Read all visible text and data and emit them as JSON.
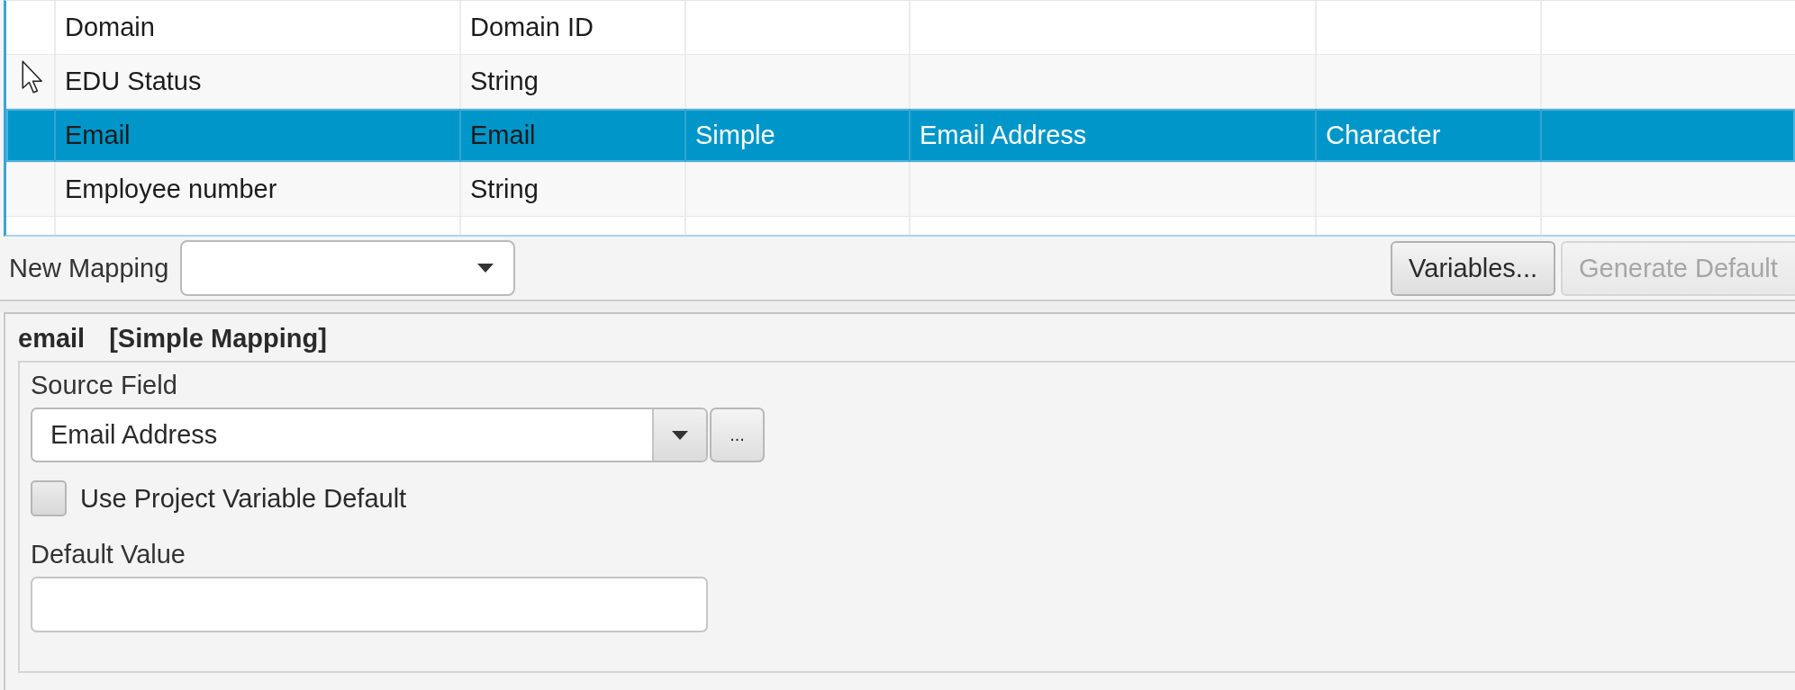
{
  "table": {
    "rows": [
      {
        "selected": false,
        "column_1": "Domain",
        "column_2": "Domain ID"
      },
      {
        "selected": false,
        "column_1": "EDU Status",
        "column_2": "String"
      },
      {
        "selected": true,
        "column_1": "Email",
        "column_2": "Email",
        "column_3": "Simple",
        "column_4": "Email Address",
        "column_5": "Character"
      },
      {
        "selected": false,
        "column_1": "Employee number",
        "column_2": "String"
      }
    ]
  },
  "toolbar": {
    "new_mapping": {
      "label": "New Mapping"
    },
    "buttons": [
      {
        "label": "Variables...",
        "disabled": false
      },
      {
        "label": "Generate Default",
        "disabled": true
      }
    ]
  },
  "mapping": {
    "name": "email",
    "type": "[Simple Mapping]",
    "source_field": {
      "label": "Source Field",
      "value": "Email Address",
      "browse_button": "..."
    },
    "use_project_variable_default": {
      "label": "Use Project Variable Default",
      "checked": false
    },
    "default_value": {
      "label": "Default Value"
    }
  }
}
